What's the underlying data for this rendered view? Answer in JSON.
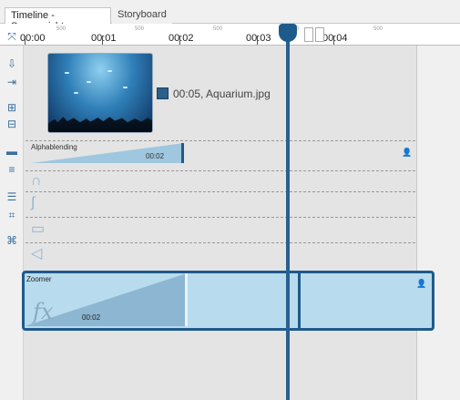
{
  "tabs": [
    {
      "label": "Timeline - Spuransicht",
      "active": true
    },
    {
      "label": "Storyboard",
      "active": false
    }
  ],
  "ruler": {
    "labels": [
      "00:00",
      "00:01",
      "00:02",
      "00:03",
      "00:04"
    ],
    "sub_label": "500"
  },
  "image_track": {
    "duration": "00:05",
    "filename": "Aquarium.jpg",
    "label": "00:05, Aquarium.jpg"
  },
  "blending": {
    "label": "Alphablending",
    "time": "00:02"
  },
  "effect": {
    "label": "Zoomer",
    "time": "00:02",
    "icon": "fx"
  },
  "colors": {
    "accent": "#1f5a8c",
    "track_fill": "#b8dced"
  }
}
